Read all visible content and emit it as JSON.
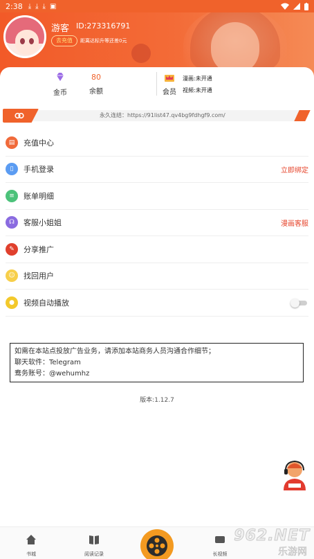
{
  "statusbar": {
    "time": "2:38"
  },
  "header": {
    "username": "游客",
    "user_id": "ID:273316791",
    "recharge_label": "去充值",
    "upgrade_note": "距离达标升等还差0元"
  },
  "stats": {
    "coins": {
      "value": "",
      "label": "金币"
    },
    "balance": {
      "value": "80",
      "label": "余额"
    },
    "member": {
      "label": "会员",
      "comic": "漫画:未开通",
      "video": "视频:未开通"
    }
  },
  "permanent_link": {
    "text": "永久连结：https://91list47.qv4bg9fdhgf9.com/"
  },
  "menu": {
    "items": [
      {
        "label": "充值中心",
        "right": "",
        "icon": "wallet-icon",
        "color": "#f06a3a"
      },
      {
        "label": "手机登录",
        "right": "立即绑定",
        "icon": "phone-icon",
        "color": "#5b9cf2"
      },
      {
        "label": "账单明细",
        "right": "",
        "icon": "bill-icon",
        "color": "#4cc27a"
      },
      {
        "label": "客服小姐姐",
        "right": "漫画客服",
        "icon": "headset-icon",
        "color": "#8a6be0"
      },
      {
        "label": "分享推广",
        "right": "",
        "icon": "share-icon",
        "color": "#e0402d"
      },
      {
        "label": "找回用户",
        "right": "",
        "icon": "user-recover-icon",
        "color": "#f7cf4a"
      },
      {
        "label": "视频自动播放",
        "right": "",
        "icon": "autoplay-icon",
        "color": "#f3c92b",
        "toggle": false
      }
    ]
  },
  "ad": {
    "line1": "如需在本站点投放广告业务，请添加本站商务人员沟通合作细节；",
    "line2": "聊天软件：Telegram",
    "line3": "鸯务账号：@wehumhz"
  },
  "version": "版本:1.12.7",
  "bottom_nav": {
    "items": [
      {
        "label": "书城",
        "icon": "home-icon"
      },
      {
        "label": "阅读记录",
        "icon": "book-icon"
      },
      {
        "label": "",
        "icon": "film-reel-icon"
      },
      {
        "label": "长视频",
        "icon": "video-icon"
      }
    ]
  },
  "watermark": {
    "top": "962.NET",
    "bottom": "乐游网"
  },
  "colors": {
    "accent": "#f0622b",
    "link_red": "#e6452c",
    "center_button": "#f39a21"
  }
}
